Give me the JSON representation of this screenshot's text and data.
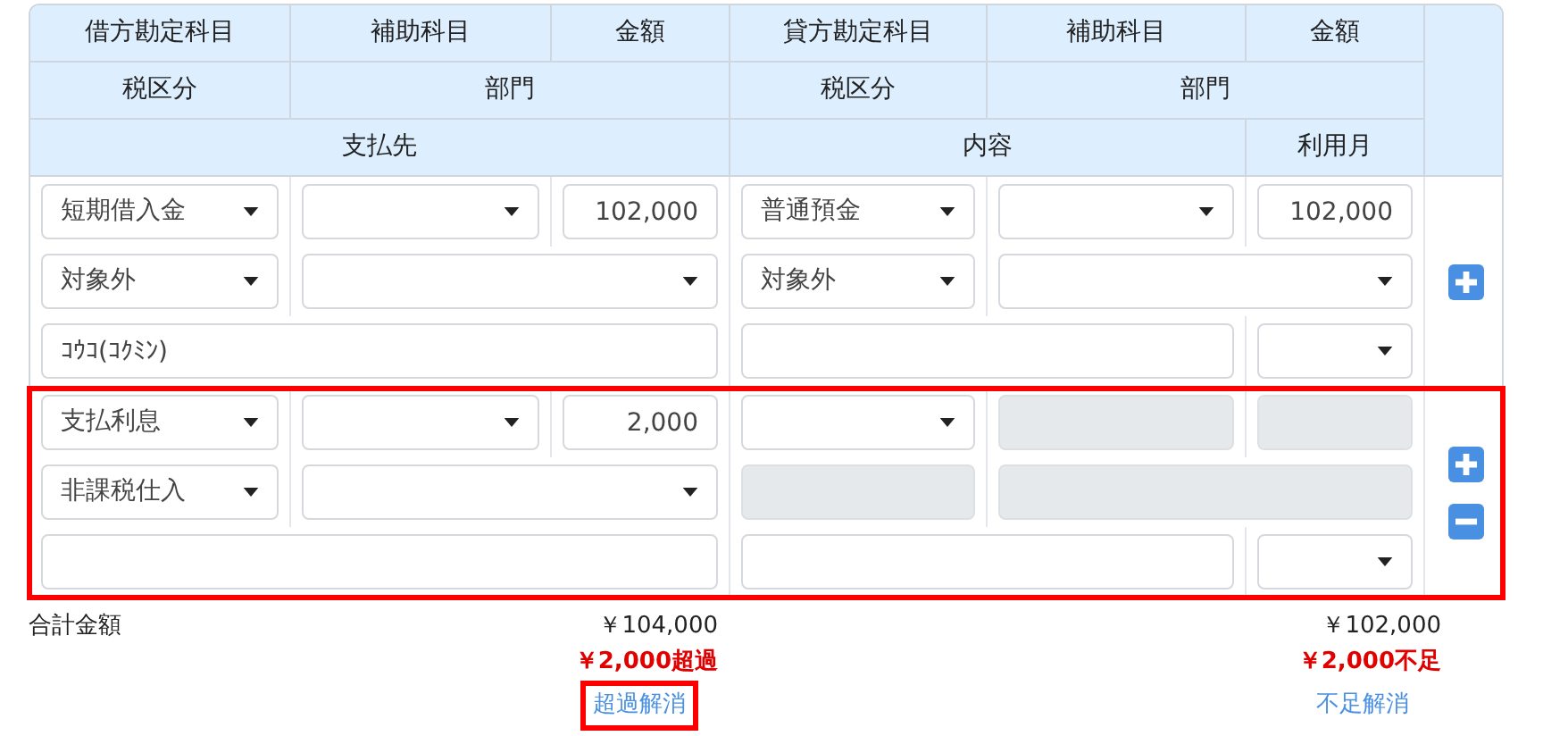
{
  "header": {
    "row_1": [
      "借方勘定科目",
      "補助科目",
      "金額",
      "貸方勘定科目",
      "補助科目",
      "金額"
    ],
    "row_2": [
      "税区分",
      "部門",
      "税区分",
      "部門"
    ],
    "row_3": [
      "支払先",
      "内容",
      "利用月"
    ]
  },
  "entries": [
    {
      "highlighted": false,
      "debit": {
        "account": {
          "value": "短期借入金",
          "disabled": false
        },
        "sub_account": {
          "disabled": false
        },
        "amount": {
          "value": "102,000",
          "disabled": false
        },
        "tax": {
          "value": "対象外",
          "disabled": false
        },
        "department": {
          "disabled": false
        },
        "payee": {
          "value": "ｺｳｺ(ｺｸﾐﾝ)",
          "disabled": false
        }
      },
      "credit": {
        "account": {
          "value": "普通預金",
          "disabled": false
        },
        "sub_account": {
          "disabled": false
        },
        "amount": {
          "value": "102,000",
          "disabled": false
        },
        "tax": {
          "value": "対象外",
          "disabled": false
        },
        "department": {
          "disabled": false
        },
        "content": {
          "disabled": false
        },
        "month": {
          "disabled": false
        }
      },
      "actions": [
        {
          "kind": "add"
        }
      ]
    },
    {
      "highlighted": true,
      "debit": {
        "account": {
          "value": "支払利息",
          "disabled": false
        },
        "sub_account": {
          "disabled": false
        },
        "amount": {
          "value": "2,000",
          "disabled": false
        },
        "tax": {
          "value": "非課税仕入",
          "disabled": false
        },
        "department": {
          "disabled": false
        },
        "payee": {
          "disabled": false
        }
      },
      "credit": {
        "account": {
          "disabled": false
        },
        "sub_account": {
          "disabled": true
        },
        "amount": {
          "disabled": true
        },
        "tax": {
          "disabled": true
        },
        "department": {
          "disabled": true
        },
        "content": {
          "disabled": false
        },
        "month": {
          "disabled": false
        }
      },
      "actions": [
        {
          "kind": "add"
        },
        {
          "kind": "remove"
        }
      ]
    }
  ],
  "totals": {
    "label": "合計金額",
    "debit": {
      "total": "￥104,000",
      "difference": "￥2,000超過",
      "fix_link": {
        "label": "超過解消",
        "highlighted": true
      }
    },
    "credit": {
      "total": "￥102,000",
      "difference": "￥2,000不足",
      "fix_link": {
        "label": "不足解消",
        "highlighted": false
      }
    }
  }
}
